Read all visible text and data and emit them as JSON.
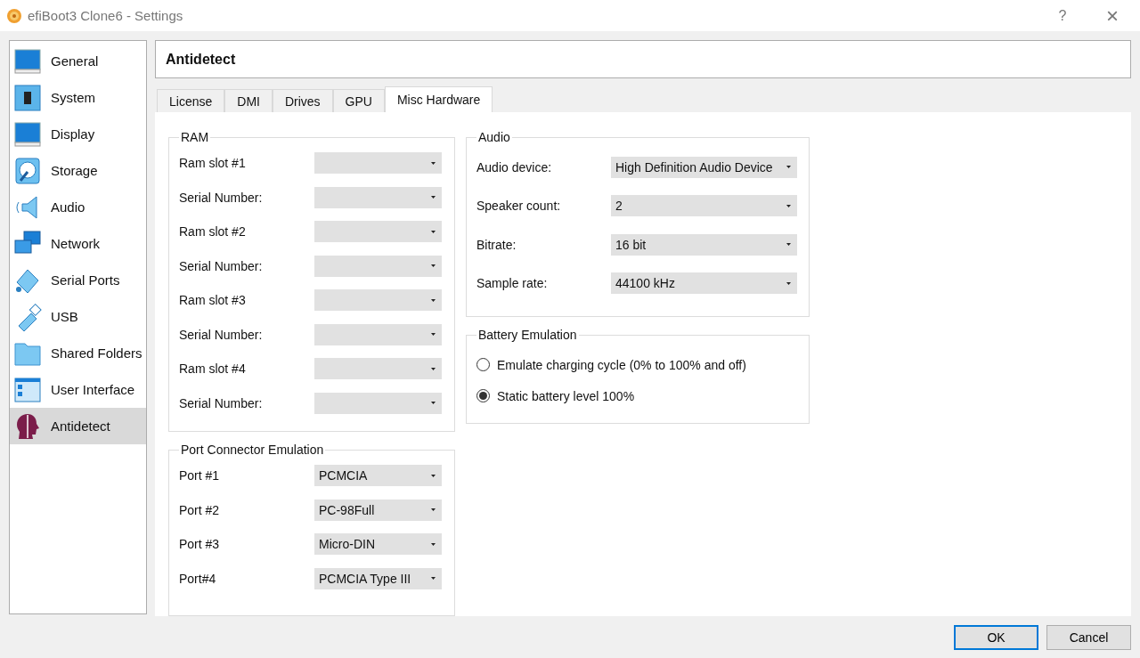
{
  "window": {
    "title": "efiBoot3 Clone6 - Settings",
    "help": "?",
    "close": "×"
  },
  "sidebar": {
    "items": [
      {
        "label": "General",
        "selected": false
      },
      {
        "label": "System",
        "selected": false
      },
      {
        "label": "Display",
        "selected": false
      },
      {
        "label": "Storage",
        "selected": false
      },
      {
        "label": "Audio",
        "selected": false
      },
      {
        "label": "Network",
        "selected": false
      },
      {
        "label": "Serial Ports",
        "selected": false
      },
      {
        "label": "USB",
        "selected": false
      },
      {
        "label": "Shared Folders",
        "selected": false
      },
      {
        "label": "User Interface",
        "selected": false
      },
      {
        "label": "Antidetect",
        "selected": true
      }
    ]
  },
  "page_title": "Antidetect",
  "tabs": [
    {
      "label": "License",
      "selected": false
    },
    {
      "label": "DMI",
      "selected": false
    },
    {
      "label": "Drives",
      "selected": false
    },
    {
      "label": "GPU",
      "selected": false
    },
    {
      "label": "Misc Hardware",
      "selected": true
    }
  ],
  "ram": {
    "title": "RAM",
    "rows": [
      {
        "label": "Ram slot #1"
      },
      {
        "label": "Serial Number:"
      },
      {
        "label": "Ram slot #2"
      },
      {
        "label": "Serial Number:"
      },
      {
        "label": "Ram slot #3"
      },
      {
        "label": "Serial Number:"
      },
      {
        "label": "Ram slot #4"
      },
      {
        "label": "Serial Number:"
      }
    ]
  },
  "port_connectors": {
    "title": "Port Connector Emulation",
    "rows": [
      {
        "label": "Port #1",
        "value": "PCMCIA"
      },
      {
        "label": "Port #2",
        "value": "PC-98Full"
      },
      {
        "label": "Port #3",
        "value": "Micro-DIN"
      },
      {
        "label": "Port#4",
        "value": "PCMCIA Type III"
      }
    ]
  },
  "audio": {
    "title": "Audio",
    "rows": [
      {
        "label": "Audio device:",
        "value": "High Definition Audio Device"
      },
      {
        "label": "Speaker count:",
        "value": "2"
      },
      {
        "label": "Bitrate:",
        "value": "16 bit"
      },
      {
        "label": "Sample rate:",
        "value": "44100 kHz"
      }
    ]
  },
  "battery": {
    "title": "Battery Emulation",
    "options": [
      {
        "label": "Emulate charging cycle (0% to 100% and off)",
        "selected": false
      },
      {
        "label": "Static battery level 100%",
        "selected": true
      }
    ]
  },
  "buttons": [
    {
      "label": "OK",
      "default": true
    },
    {
      "label": "Cancel",
      "default": false
    }
  ]
}
